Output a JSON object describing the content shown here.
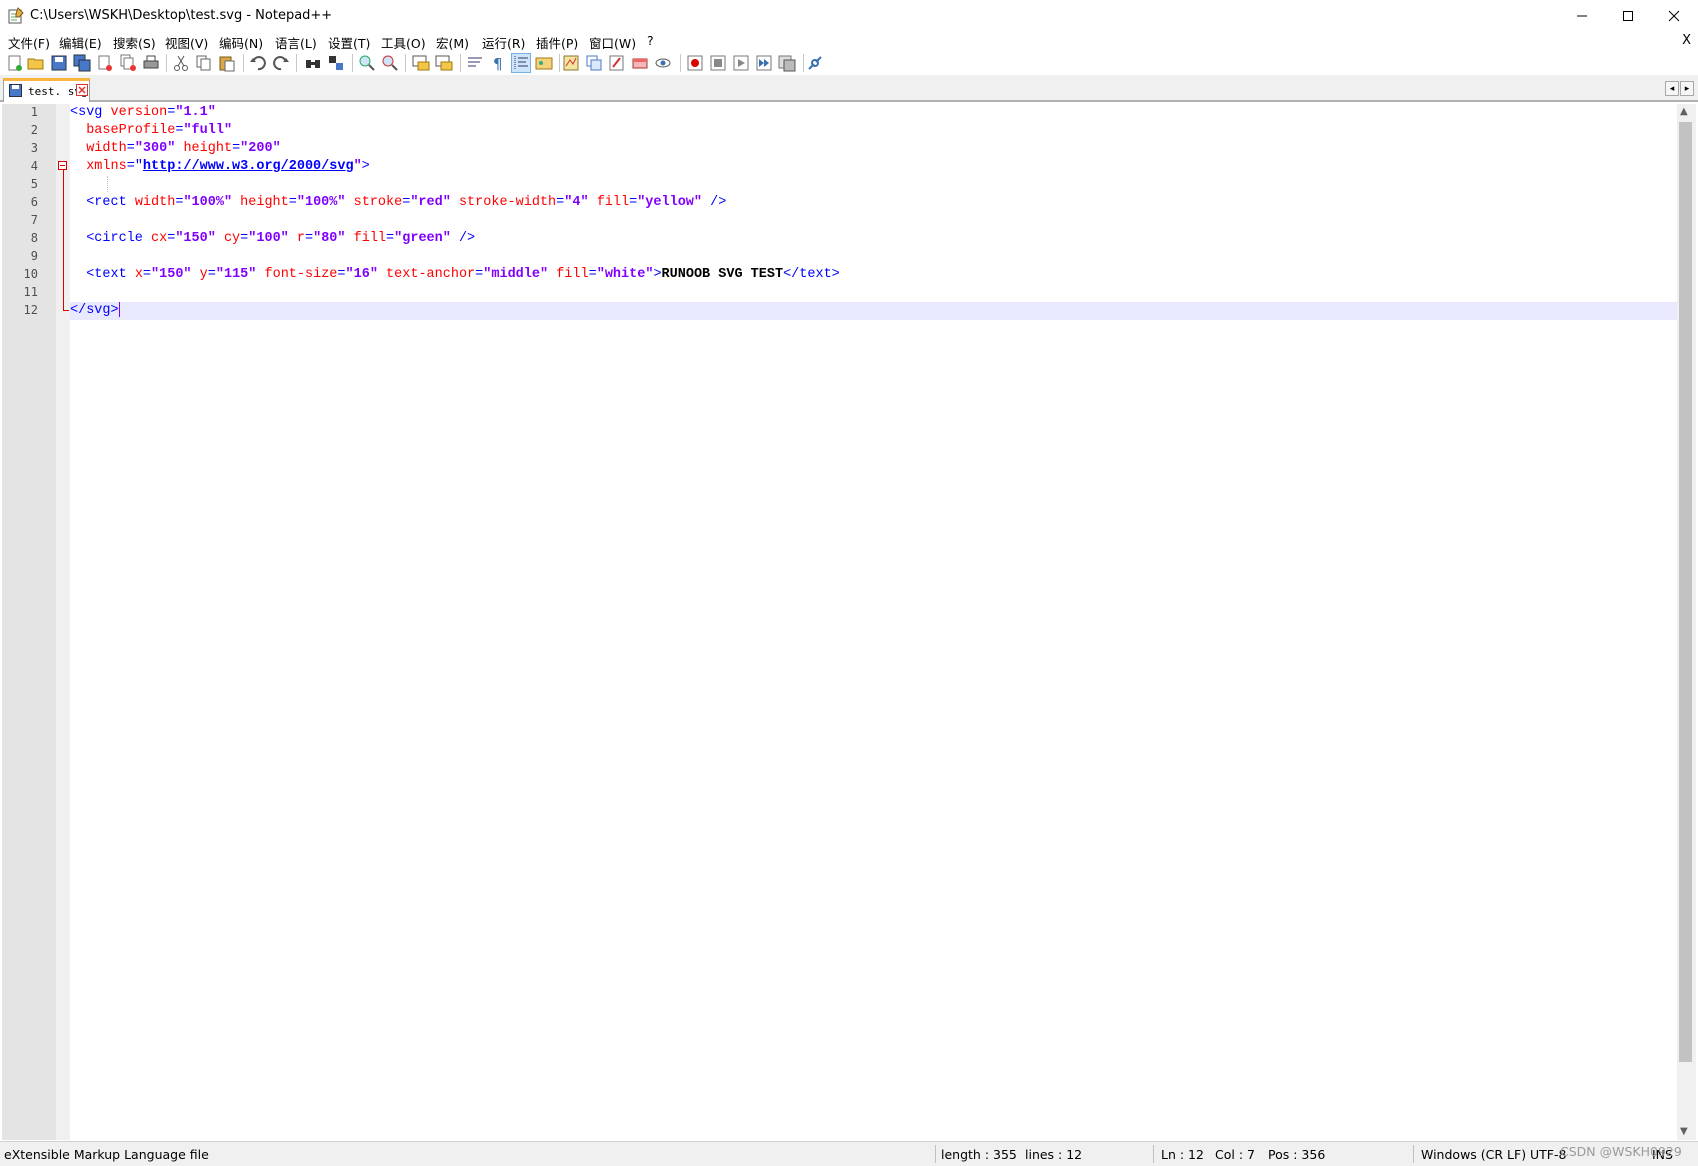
{
  "window": {
    "title": "C:\\Users\\WSKH\\Desktop\\test.svg - Notepad++",
    "minimize_glyph": "—",
    "maximize_glyph": "☐",
    "close_glyph": "✕"
  },
  "menu": {
    "items": [
      "文件(F)",
      "编辑(E)",
      "搜索(S)",
      "视图(V)",
      "编码(N)",
      "语言(L)",
      "设置(T)",
      "工具(O)",
      "宏(M)",
      "运行(R)",
      "插件(P)",
      "窗口(W)",
      "?"
    ],
    "close_label": "X"
  },
  "toolbar": {
    "icons": [
      "new-file-icon",
      "open-file-icon",
      "save-icon",
      "save-all-icon",
      "close-icon",
      "close-all-icon",
      "print-icon",
      "cut-icon",
      "copy-icon",
      "paste-icon",
      "undo-icon",
      "redo-icon",
      "find-icon",
      "replace-icon",
      "zoom-in-icon",
      "zoom-out-icon",
      "sync-vertical-icon",
      "sync-horizontal-icon",
      "word-wrap-icon",
      "show-all-chars-icon",
      "indent-guide-icon",
      "user-lang-icon",
      "doc-map-icon",
      "function-list-icon",
      "folder-workspace-icon",
      "doc-switcher-icon",
      "monitoring-icon",
      "record-macro-icon",
      "stop-macro-icon",
      "play-macro-icon",
      "run-macro-multiple-icon",
      "save-macro-icon",
      "plugin-icon"
    ],
    "active_icon": "indent-guide-icon"
  },
  "tabs": [
    {
      "label": "test. svg",
      "active": true
    }
  ],
  "tab_nav": {
    "prev": "◂",
    "next": "▸"
  },
  "editor": {
    "lines": [
      [
        [
          "tag",
          "<svg "
        ],
        [
          "attr",
          "version"
        ],
        [
          "tag",
          "="
        ],
        [
          "val",
          "\"1.1\""
        ]
      ],
      [
        [
          "tag",
          "  "
        ],
        [
          "attr",
          "baseProfile"
        ],
        [
          "tag",
          "="
        ],
        [
          "val",
          "\"full\""
        ]
      ],
      [
        [
          "tag",
          "  "
        ],
        [
          "attr",
          "width"
        ],
        [
          "tag",
          "="
        ],
        [
          "val",
          "\"300\""
        ],
        [
          "tag",
          " "
        ],
        [
          "attr",
          "height"
        ],
        [
          "tag",
          "="
        ],
        [
          "val",
          "\"200\""
        ]
      ],
      [
        [
          "tag",
          "  "
        ],
        [
          "attr",
          "xmlns"
        ],
        [
          "tag",
          "=\""
        ],
        [
          "url",
          "http://www.w3.org/2000/svg"
        ],
        [
          "val",
          "\""
        ],
        [
          "tag",
          ">"
        ]
      ],
      [
        [
          "tag",
          ""
        ]
      ],
      [
        [
          "tag",
          "  <rect "
        ],
        [
          "attr",
          "width"
        ],
        [
          "tag",
          "="
        ],
        [
          "val",
          "\"100%\""
        ],
        [
          "tag",
          " "
        ],
        [
          "attr",
          "height"
        ],
        [
          "tag",
          "="
        ],
        [
          "val",
          "\"100%\""
        ],
        [
          "tag",
          " "
        ],
        [
          "attr",
          "stroke"
        ],
        [
          "tag",
          "="
        ],
        [
          "val",
          "\"red\""
        ],
        [
          "tag",
          " "
        ],
        [
          "attr",
          "stroke-width"
        ],
        [
          "tag",
          "="
        ],
        [
          "val",
          "\"4\""
        ],
        [
          "tag",
          " "
        ],
        [
          "attr",
          "fill"
        ],
        [
          "tag",
          "="
        ],
        [
          "val",
          "\"yellow\""
        ],
        [
          "tag",
          " />"
        ]
      ],
      [
        [
          "tag",
          ""
        ]
      ],
      [
        [
          "tag",
          "  <circle "
        ],
        [
          "attr",
          "cx"
        ],
        [
          "tag",
          "="
        ],
        [
          "val",
          "\"150\""
        ],
        [
          "tag",
          " "
        ],
        [
          "attr",
          "cy"
        ],
        [
          "tag",
          "="
        ],
        [
          "val",
          "\"100\""
        ],
        [
          "tag",
          " "
        ],
        [
          "attr",
          "r"
        ],
        [
          "tag",
          "="
        ],
        [
          "val",
          "\"80\""
        ],
        [
          "tag",
          " "
        ],
        [
          "attr",
          "fill"
        ],
        [
          "tag",
          "="
        ],
        [
          "val",
          "\"green\""
        ],
        [
          "tag",
          " />"
        ]
      ],
      [
        [
          "tag",
          ""
        ]
      ],
      [
        [
          "tag",
          "  <text "
        ],
        [
          "attr",
          "x"
        ],
        [
          "tag",
          "="
        ],
        [
          "val",
          "\"150\""
        ],
        [
          "tag",
          " "
        ],
        [
          "attr",
          "y"
        ],
        [
          "tag",
          "="
        ],
        [
          "val",
          "\"115\""
        ],
        [
          "tag",
          " "
        ],
        [
          "attr",
          "font-size"
        ],
        [
          "tag",
          "="
        ],
        [
          "val",
          "\"16\""
        ],
        [
          "tag",
          " "
        ],
        [
          "attr",
          "text-anchor"
        ],
        [
          "tag",
          "="
        ],
        [
          "val",
          "\"middle\""
        ],
        [
          "tag",
          " "
        ],
        [
          "attr",
          "fill"
        ],
        [
          "tag",
          "="
        ],
        [
          "val",
          "\"white\""
        ],
        [
          "tag",
          ">"
        ],
        [
          "text",
          "RUNOOB SVG TEST"
        ],
        [
          "tag",
          "</text>"
        ]
      ],
      [
        [
          "tag",
          ""
        ]
      ],
      [
        [
          "tag",
          "</svg>"
        ]
      ]
    ],
    "line_numbers": [
      "1",
      "2",
      "3",
      "4",
      "5",
      "6",
      "7",
      "8",
      "9",
      "10",
      "11",
      "12"
    ],
    "current_line": 12,
    "colors": {
      "tag": "#0000ff",
      "attr": "#ff0000",
      "value": "#8000ff",
      "current_line_bg": "#e8e8ff",
      "fold": "#dd0000"
    }
  },
  "statusbar": {
    "file_type": "eXtensible Markup Language file",
    "length": "length : 355",
    "lines": "lines : 12",
    "ln": "Ln : 12",
    "col": "Col : 7",
    "pos": "Pos : 356",
    "eol": "Windows (CR LF)",
    "encoding": "UTF-8",
    "mode": "INS"
  },
  "watermark": "CSDN @WSKH0929"
}
